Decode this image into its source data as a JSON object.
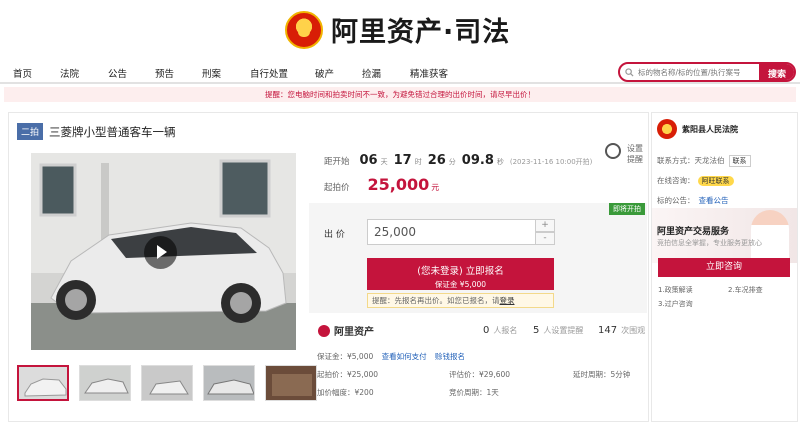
{
  "site": {
    "title": "阿里资产·司法"
  },
  "nav": {
    "items": [
      "首页",
      "法院",
      "公告",
      "预告",
      "刑案",
      "自行处置",
      "破产",
      "捡漏",
      "精准获客"
    ],
    "search_placeholder": "标的物名称/标的位置/执行案号",
    "search_button": "搜索"
  },
  "notice": "提醒：您电脑时间和拍卖时间不一致，为避免错过合理的出价时间，请尽早出价！",
  "item": {
    "round": "二拍",
    "title": "三菱牌小型普通客车一辆"
  },
  "countdown": {
    "label": "距开始",
    "days": "06",
    "days_unit": "天",
    "hours": "17",
    "hours_unit": "时",
    "minutes": "26",
    "minutes_unit": "分",
    "seconds": "09.8",
    "seconds_unit": "秒",
    "start_time": "(2023-11-16 10:00开拍)"
  },
  "start_price": {
    "label": "起拍价",
    "value": "25,000",
    "unit": "元"
  },
  "remind": {
    "line1": "设置",
    "line2": "提醒"
  },
  "bid": {
    "live_tag": "即将开拍",
    "label": "出 价",
    "input_value": "25,000",
    "plus": "+",
    "minus": "-",
    "signup_line1": "(您未登录) 立即报名",
    "signup_line2": "保证金 ¥5,000",
    "hint_prefix": "提醒：先报名再出价。如您已报名，请",
    "hint_link": "登录"
  },
  "stats": {
    "brand": "阿里资产",
    "signup_count": "0",
    "signup_label": "人报名",
    "remind_count": "5",
    "remind_label": "人设置提醒",
    "view_count": "147",
    "view_label": "次围观"
  },
  "details": {
    "deposit": "保证金：¥5,000",
    "deposit_link1": "查看如何支付",
    "deposit_link2": "赊钱报名",
    "start_price": "起拍价：¥25,000",
    "assess_price": "评估价：¥29,600",
    "delay": "延时周期：5分钟",
    "increment": "加价幅度：¥200",
    "period": "竞价周期：1天"
  },
  "court": {
    "name": "紫阳县人民法院",
    "contact_label": "联系方式：",
    "contact_value": "天龙法伯",
    "contact_button": "联系",
    "online_label": "在线咨询：",
    "online_button": "阿旺联系",
    "notice_label": "标的公告：",
    "notice_link": "查看公告"
  },
  "service": {
    "title": "阿里资产交易服务",
    "subtitle": "竞拍信息全掌握，专业服务更放心",
    "consult_button": "立即咨询",
    "step1": "1.政策解读",
    "step2": "2.车况排查",
    "step3": "3.过户咨询"
  },
  "colors": {
    "brand_red": "#c4143c",
    "link_blue": "#1f5fb8",
    "badge_blue": "#4a6ea8",
    "live_green": "#3a9a3a"
  }
}
